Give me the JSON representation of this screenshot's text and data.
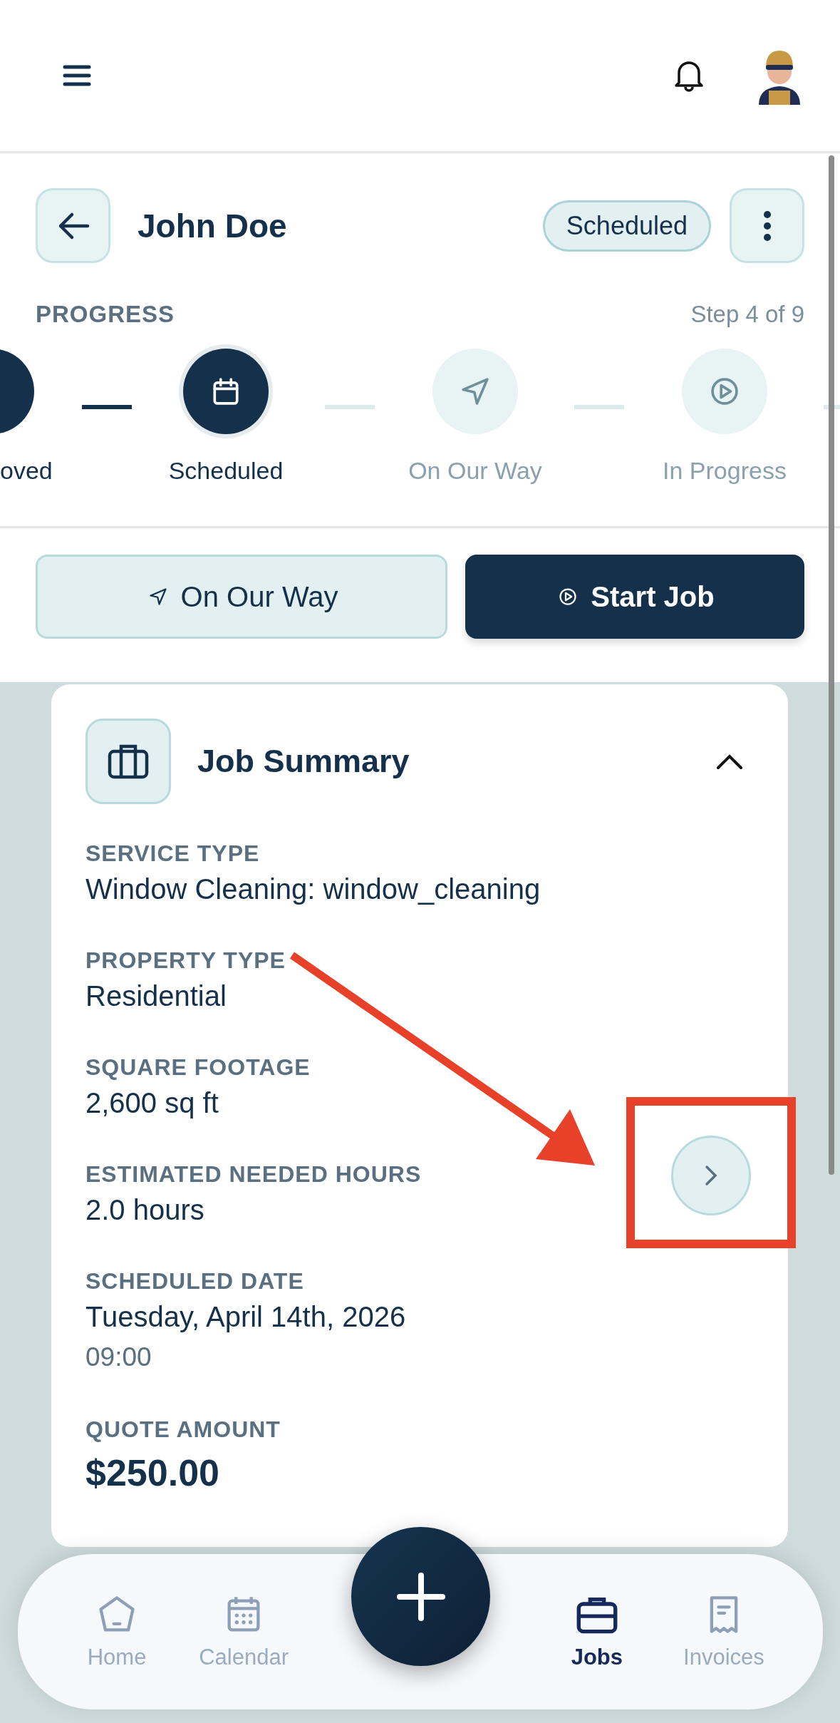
{
  "header": {
    "title": "John Doe",
    "status": "Scheduled"
  },
  "progress": {
    "label": "PROGRESS",
    "step_text": "Step 4 of 9",
    "steps": [
      {
        "label": "oved",
        "completed": true,
        "current": false
      },
      {
        "label": "Scheduled",
        "completed": true,
        "current": true
      },
      {
        "label": "On Our Way",
        "completed": false,
        "current": false
      },
      {
        "label": "In Progress",
        "completed": false,
        "current": false
      }
    ]
  },
  "actions": [
    {
      "label": "On Our Way",
      "kind": "secondary"
    },
    {
      "label": "Start Job",
      "kind": "primary"
    }
  ],
  "card": {
    "title": "Job Summary",
    "expanded": true,
    "fields": [
      {
        "label": "SERVICE TYPE",
        "value": "Window Cleaning: window_cleaning"
      },
      {
        "label": "PROPERTY TYPE",
        "value": "Residential"
      },
      {
        "label": "SQUARE FOOTAGE",
        "value": "2,600 sq ft"
      },
      {
        "label": "ESTIMATED NEEDED HOURS",
        "value": "2.0 hours"
      },
      {
        "label": "SCHEDULED DATE",
        "value": "Tuesday, April 14th, 2026",
        "secondary": "09:00"
      },
      {
        "label": "QUOTE AMOUNT",
        "value": "$250.00",
        "kind": "amount"
      }
    ]
  },
  "nav": [
    {
      "label": "Home",
      "selected": false
    },
    {
      "label": "Calendar",
      "selected": false
    },
    {
      "label": "Jobs",
      "selected": true
    },
    {
      "label": "Invoices",
      "selected": false
    }
  ]
}
